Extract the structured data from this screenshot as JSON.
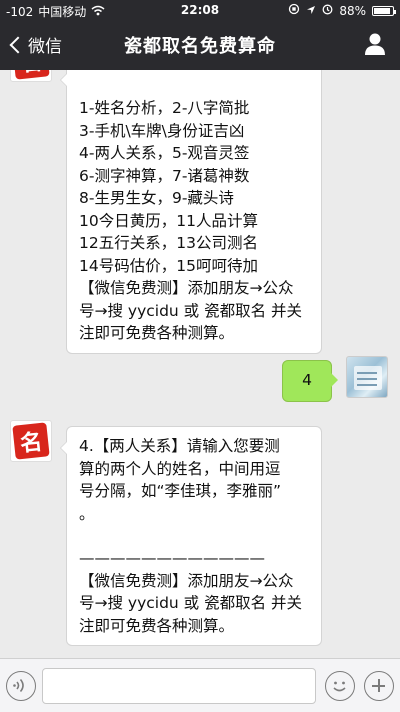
{
  "status_bar": {
    "signal": "-102",
    "carrier": "中国移动",
    "time": "22:08",
    "battery": "88%",
    "battery_level": 0.88
  },
  "nav": {
    "back_label": "微信",
    "title": "瓷都取名免费算命"
  },
  "messages": [
    {
      "from": "official",
      "lines": [
        "1-姓名分析，2-八字简批",
        "3-手机\\车牌\\身份证吉凶",
        "4-两人关系，5-观音灵签",
        "6-测字神算，7-诸葛神数",
        "8-生男生女，9-藏头诗",
        "10今日黄历，11人品计算",
        "12五行关系，13公司测名",
        "14号码估价，15呵呵待加",
        "【微信免费测】添加朋友→公众",
        "号→搜 yycidu 或 瓷都取名 并关",
        "注即可免费各种测算。"
      ]
    },
    {
      "from": "user",
      "lines": [
        "4"
      ]
    },
    {
      "from": "official",
      "avatar_text": "名",
      "lines": [
        "4.【两人关系】请输入您要测",
        "算的两个人的姓名，中间用逗",
        "号分隔，如“李佳琪，李雅丽”",
        "。",
        "",
        "————————————",
        "【微信免费测】添加朋友→公众",
        "号→搜 yycidu 或 瓷都取名 并关",
        "注即可免费各种测算。"
      ]
    }
  ],
  "input": {
    "value": "",
    "placeholder": ""
  },
  "icons": {
    "back": "chevron-left-icon",
    "user": "person-icon",
    "voice": "voice-icon",
    "emoji": "emoji-icon",
    "plus": "plus-icon"
  },
  "colors": {
    "bar": "#2a2a2e",
    "chat_bg": "#ebebeb",
    "user_bubble": "#a0e75a",
    "seal_red": "#d8261c"
  }
}
